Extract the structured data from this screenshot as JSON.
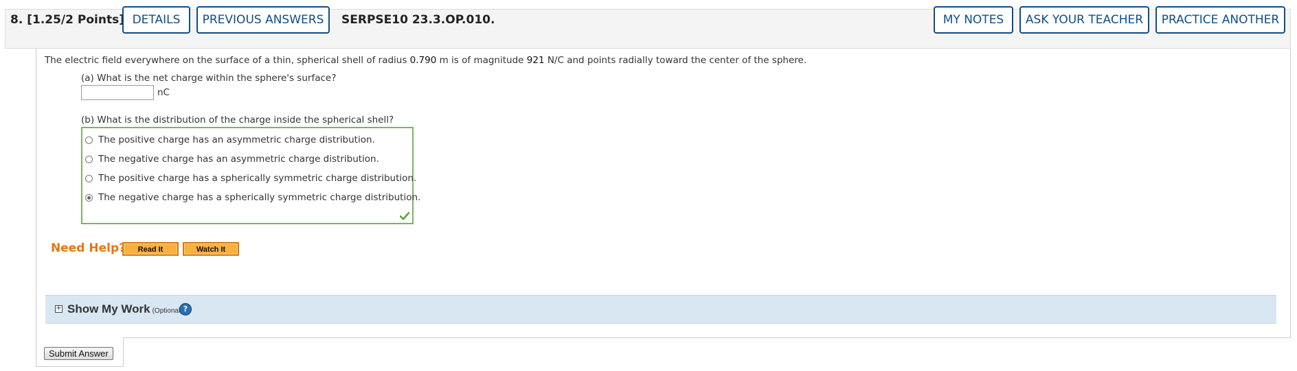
{
  "question": {
    "number": "8.",
    "points": "[1.25/2 Points]",
    "code": "SERPSE10 23.3.OP.010.",
    "header_buttons": {
      "details": "DETAILS",
      "previous_answers": "PREVIOUS ANSWERS",
      "my_notes": "MY NOTES",
      "ask_teacher": "ASK YOUR TEACHER",
      "practice_another": "PRACTICE ANOTHER"
    },
    "prompt_parts": {
      "p1": "The electric field everywhere on the surface of a thin, spherical shell of radius ",
      "radius": "0.790",
      "p2": " m is of magnitude ",
      "magnitude": "921",
      "p3": " N/C and points radially toward the center of the sphere."
    },
    "part_a": {
      "label": "(a) What is the net charge within the sphere's surface?",
      "value": "",
      "unit": "nC"
    },
    "part_b": {
      "label": "(b) What is the distribution of the charge inside the spherical shell?",
      "options": [
        "The positive charge has an asymmetric charge distribution.",
        "The negative charge has an asymmetric charge distribution.",
        "The positive charge has a spherically symmetric charge distribution.",
        "The negative charge has a spherically symmetric charge distribution."
      ],
      "selected_option": "The negative charge has a spherically symmetric charge distribution."
    },
    "need_help": {
      "label": "Need Help?",
      "read_it": "Read It",
      "watch_it": "Watch It"
    },
    "show_my_work": {
      "title": "Show My Work",
      "optional": "(Optional)",
      "help_glyph": "?"
    },
    "submit_label": "Submit Answer"
  },
  "colors": {
    "header_button_border": "#0e4d8a",
    "correct_border": "#7ab55c",
    "need_help_text": "#e87511",
    "help_button_fill": "#f8b13d",
    "show_my_work_bg": "#d9e7f2"
  },
  "icons": {
    "correct": "checkmark-icon",
    "expand": "plus-box-icon",
    "help": "question-circle-icon"
  }
}
